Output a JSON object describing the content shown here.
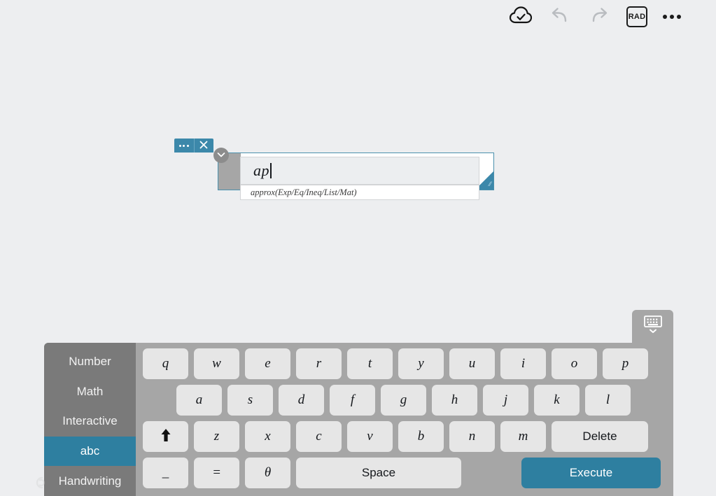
{
  "toolbar": {
    "save_icon": "cloud-check-icon",
    "undo_icon": "undo-arrow-icon",
    "redo_icon": "redo-arrow-icon",
    "angle_mode_label": "RAD",
    "more_icon": "more-options-icon"
  },
  "dialog": {
    "more_icon": "more-options-icon",
    "close_icon": "close-icon",
    "collapse_icon": "chevron-down-icon",
    "resize_icon": "resize-handle-icon",
    "input_value": "ap",
    "suggestion": "approx(Exp/Eq/Ineq/List/Mat)"
  },
  "keyboard": {
    "hide_icon": "hide-keyboard-icon",
    "tabs": [
      {
        "label": "Number",
        "active": false
      },
      {
        "label": "Math",
        "active": false
      },
      {
        "label": "Interactive",
        "active": false
      },
      {
        "label": "abc",
        "active": true
      },
      {
        "label": "Handwriting",
        "active": false
      }
    ],
    "row1": [
      "q",
      "w",
      "e",
      "r",
      "t",
      "y",
      "u",
      "i",
      "o",
      "p"
    ],
    "row2": [
      "a",
      "s",
      "d",
      "f",
      "g",
      "h",
      "j",
      "k",
      "l"
    ],
    "row3_shift": "⬆",
    "row3": [
      "z",
      "x",
      "c",
      "v",
      "b",
      "n",
      "m"
    ],
    "row3_delete": "Delete",
    "row4": [
      "_",
      "=",
      "θ"
    ],
    "row4_space": "Space",
    "row4_execute": "Execute"
  },
  "colors": {
    "page_bg": "#edeef0",
    "accent_teal": "#2e7fa0",
    "dialog_header": "#3c88aa",
    "keyboard_bg": "#a6a6a6",
    "sidebar_bg": "#7a7a7a",
    "key_bg": "#e6e6e6"
  }
}
